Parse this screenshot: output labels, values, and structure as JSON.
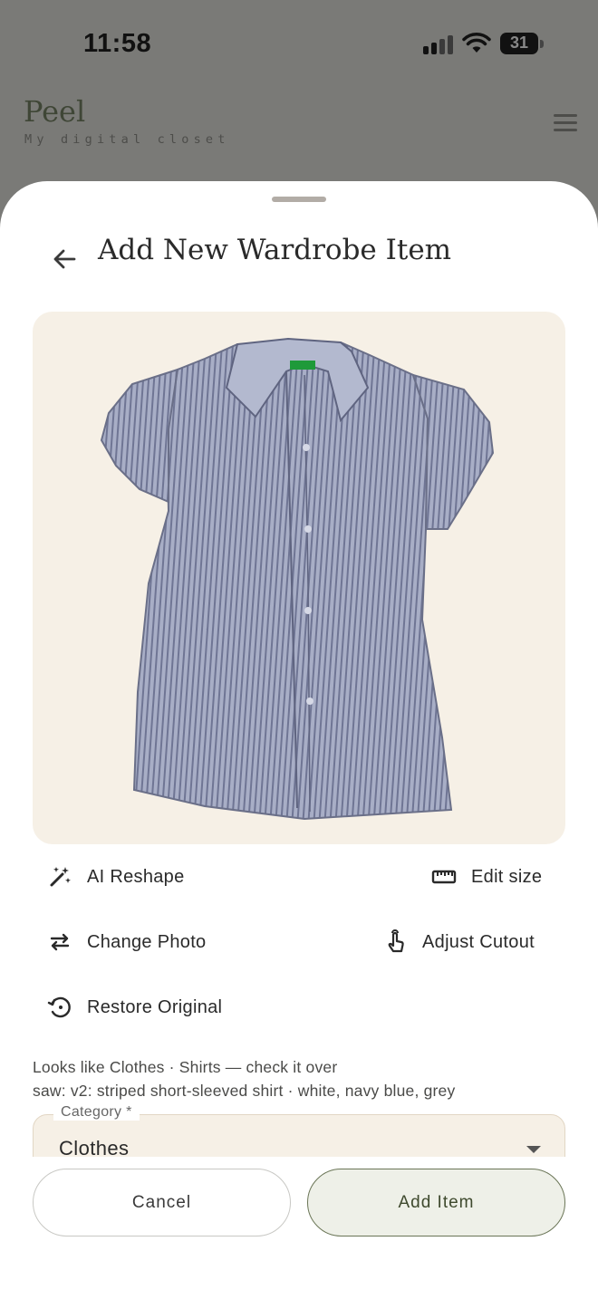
{
  "status_bar": {
    "time": "11:58",
    "battery": "31"
  },
  "app": {
    "brand": "Peel",
    "tagline": "My digital closet",
    "menu_icon": "hamburger-menu-icon"
  },
  "sheet": {
    "title": "Add New Wardrobe Item",
    "back_icon": "arrow-left-icon",
    "photo_alt": "striped short-sleeved shirt",
    "actions": {
      "ai_reshape": {
        "label": "AI Reshape",
        "icon": "magic-wand-icon"
      },
      "edit_size": {
        "label": "Edit size",
        "icon": "ruler-icon"
      },
      "change_photo": {
        "label": "Change Photo",
        "icon": "swap-arrows-icon"
      },
      "adjust_cutout": {
        "label": "Adjust Cutout",
        "icon": "touch-hand-icon"
      },
      "restore_original": {
        "label": "Restore Original",
        "icon": "history-restore-icon"
      }
    },
    "hint_line1": "Looks like Clothes · Shirts — check it over",
    "hint_line2": "saw: v2: striped short-sleeved shirt · white, navy blue, grey",
    "category": {
      "label": "Category *",
      "value": "Clothes"
    },
    "buttons": {
      "cancel": "Cancel",
      "add": "Add Item"
    }
  },
  "colors": {
    "backdrop": "#7a7a77",
    "accent": "#3f4a2e",
    "photo_bg": "#f6f0e6",
    "add_button_bg": "#eef0e8"
  }
}
